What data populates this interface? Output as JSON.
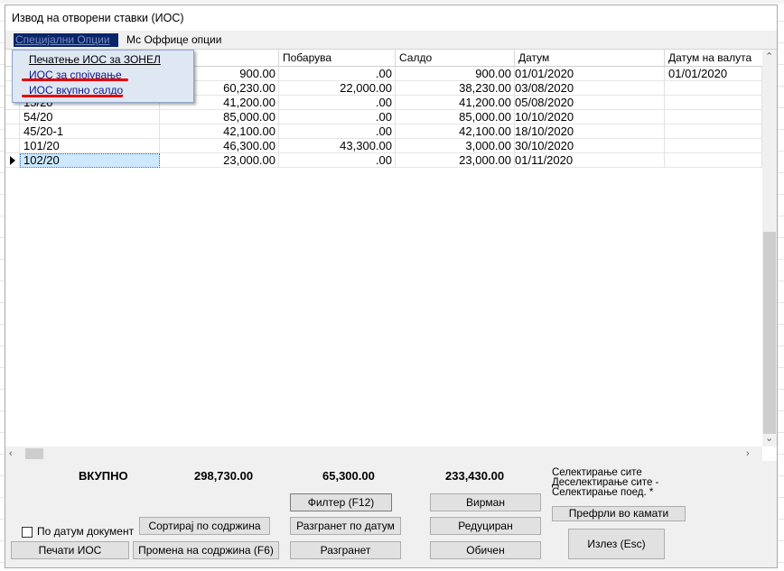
{
  "window": {
    "title": "Извод на отворени ставки (ИОС)"
  },
  "menu": {
    "special": "Специјални Опции",
    "office": "Мс Оффице опции"
  },
  "dropdown": {
    "items": [
      "Печатење ИОС за ЗОНЕЛ",
      "ИОС за спојување",
      "ИОС вкупно салдо"
    ]
  },
  "columns": [
    "",
    "Побарува",
    "Салдо",
    "Датум",
    "Датум на валута"
  ],
  "rows": [
    {
      "doc": "",
      "dolguva": "900.00",
      "pobaruva": ".00",
      "saldo": "900.00",
      "datum": "01/01/2020",
      "valuta": "01/01/2020"
    },
    {
      "doc": "",
      "dolguva": "60,230.00",
      "pobaruva": "22,000.00",
      "saldo": "38,230.00",
      "datum": "03/08/2020",
      "valuta": ""
    },
    {
      "doc": "15/20",
      "dolguva": "41,200.00",
      "pobaruva": ".00",
      "saldo": "41,200.00",
      "datum": "05/08/2020",
      "valuta": ""
    },
    {
      "doc": "54/20",
      "dolguva": "85,000.00",
      "pobaruva": ".00",
      "saldo": "85,000.00",
      "datum": "10/10/2020",
      "valuta": ""
    },
    {
      "doc": "45/20-1",
      "dolguva": "42,100.00",
      "pobaruva": ".00",
      "saldo": "42,100.00",
      "datum": "18/10/2020",
      "valuta": ""
    },
    {
      "doc": "101/20",
      "dolguva": "46,300.00",
      "pobaruva": "43,300.00",
      "saldo": "3,000.00",
      "datum": "30/10/2020",
      "valuta": ""
    },
    {
      "doc": "102/20",
      "dolguva": "23,000.00",
      "pobaruva": ".00",
      "saldo": "23,000.00",
      "datum": "01/11/2020",
      "valuta": ""
    }
  ],
  "totals": {
    "label": "ВКУПНО",
    "dolguva": "298,730.00",
    "pobaruva": "65,300.00",
    "saldo": "233,430.00"
  },
  "selection": {
    "line1": "Селектирање сите",
    "line2": "Деселектирање сите -",
    "line3": "Селектирање поед. *"
  },
  "buttons": {
    "filter": "Филтер (F12)",
    "virman": "Вирман",
    "sort": "Сортирај по содржина",
    "razgranet_datum": "Разгранет по датум",
    "reduciran": "Редуциран",
    "prefrli": "Префрли во камати",
    "print": "Печати ИОС",
    "promena": "Промена на содржина (F6)",
    "razgranet": "Разгранет",
    "obicen": "Обичен",
    "exit": "Излез (Esc)"
  },
  "checkbox": {
    "label": "По датум документ",
    "checked": false
  },
  "colors": {
    "menu_highlight": "#0a246a",
    "annotation": "#e60000",
    "selection": "#cde8ff"
  }
}
